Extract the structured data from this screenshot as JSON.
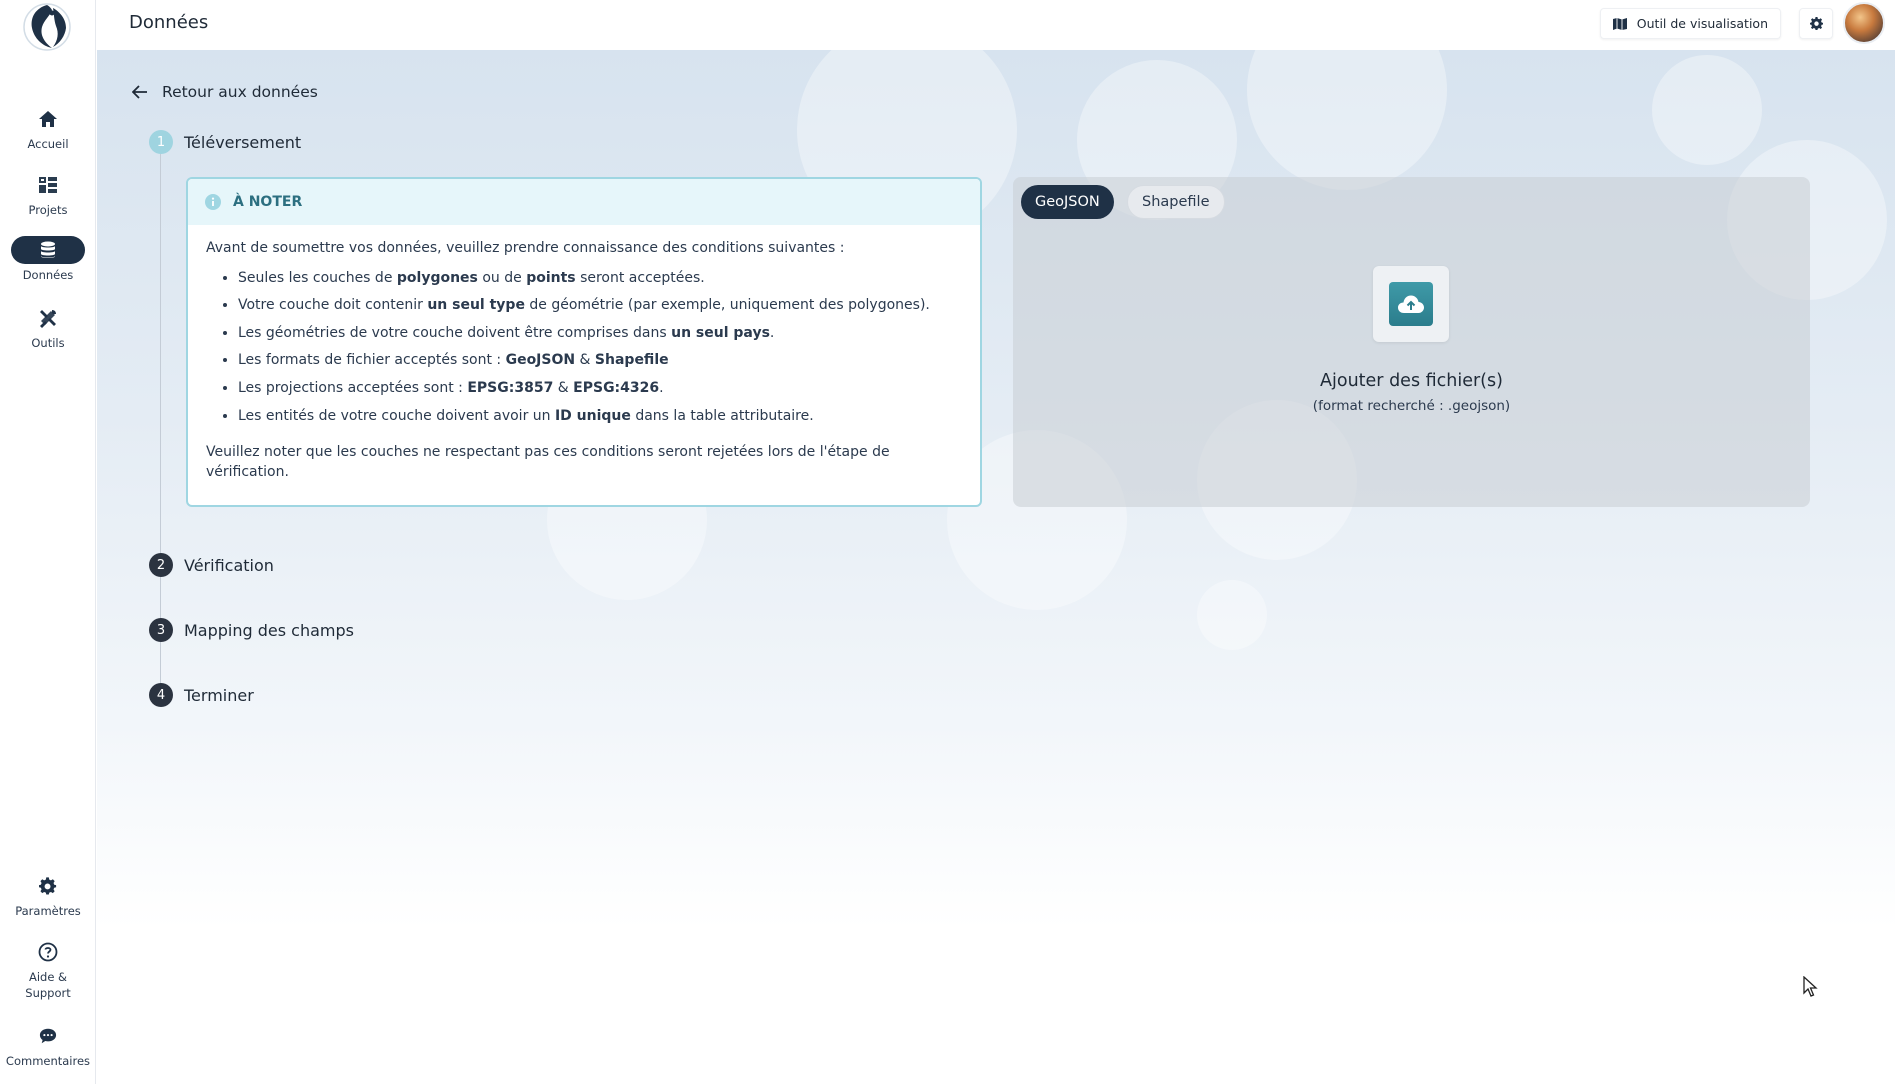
{
  "sidebar": {
    "items": [
      {
        "label": "Accueil",
        "icon": "home-icon"
      },
      {
        "label": "Projets",
        "icon": "projects-icon"
      },
      {
        "label": "Données",
        "icon": "database-icon",
        "active": true
      },
      {
        "label": "Outils",
        "icon": "tools-icon"
      }
    ],
    "bottom": [
      {
        "label": "Paramètres",
        "icon": "gear-icon"
      },
      {
        "label": "Aide & Support",
        "icon": "help-icon"
      },
      {
        "label": "Commentaires",
        "icon": "chat-icon"
      }
    ]
  },
  "header": {
    "title": "Données",
    "viz_label": "Outil de visualisation"
  },
  "back_label": "Retour aux données",
  "steps": [
    {
      "num": "1",
      "label": "Téléversement",
      "current": true
    },
    {
      "num": "2",
      "label": "Vérification"
    },
    {
      "num": "3",
      "label": "Mapping des champs"
    },
    {
      "num": "4",
      "label": "Terminer"
    }
  ],
  "note": {
    "title": "À NOTER",
    "intro": "Avant de soumettre vos données, veuillez prendre connaissance des conditions suivantes :",
    "b1": {
      "t1": "Seules les couches de ",
      "s1": "polygones",
      "t2": " ou de ",
      "s2": "points",
      "t3": " seront acceptées."
    },
    "b2": {
      "t1": "Votre couche doit contenir ",
      "s1": "un seul type",
      "t2": " de géométrie (par exemple, uniquement des polygones)."
    },
    "b3": {
      "t1": "Les géométries de votre couche doivent être comprises dans ",
      "s1": "un seul pays",
      "t2": "."
    },
    "b4": {
      "t1": "Les formats de fichier acceptés sont : ",
      "s1": "GeoJSON",
      "t2": " & ",
      "s2": "Shapefile"
    },
    "b5": {
      "t1": "Les projections acceptées sont : ",
      "s1": "EPSG:3857",
      "t2": " & ",
      "s2": "EPSG:4326",
      "t3": "."
    },
    "b6": {
      "t1": "Les entités de votre couche doivent avoir un ",
      "s1": "ID unique",
      "t2": " dans la table attributaire."
    },
    "outro": "Veuillez noter que les couches ne respectant pas ces conditions seront rejetées lors de l'étape de vérification."
  },
  "upload": {
    "tabs": [
      "GeoJSON",
      "Shapefile"
    ],
    "active_tab": "GeoJSON",
    "title": "Ajouter des fichier(s)",
    "subtitle": "(format recherché : .geojson)"
  },
  "colors": {
    "primary": "#1f3146",
    "accent": "#9fd6e2",
    "note_title": "#2c6f80"
  }
}
